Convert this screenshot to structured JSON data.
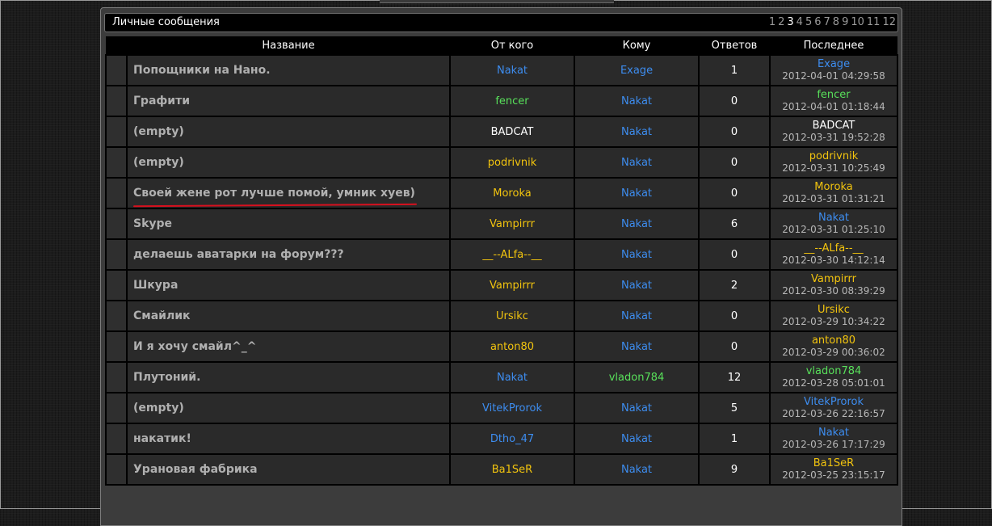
{
  "header": {
    "title": "Личные сообщения",
    "pages": [
      "1",
      "2",
      "3",
      "4",
      "5",
      "6",
      "7",
      "8",
      "9",
      "10",
      "11",
      "12"
    ],
    "current_page": "3"
  },
  "columns": {
    "title": "Название",
    "from": "От кого",
    "to": "Кому",
    "replies": "Ответов",
    "last": "Последнее"
  },
  "colors": {
    "blue": "#3d8df0",
    "green": "#58e05a",
    "yellow": "#f2c40e",
    "white": "#ffffff",
    "red_underline": "#d8101e"
  },
  "rows": [
    {
      "title": "Попощники на Нано.",
      "from": "Nakat",
      "from_color": "blue",
      "to": "Exage",
      "to_color": "blue",
      "replies": "1",
      "last_user": "Exage",
      "last_color": "blue",
      "last_ts": "2012-04-01 04:29:58",
      "underlined": false
    },
    {
      "title": "Графити",
      "from": "fencer",
      "from_color": "green",
      "to": "Nakat",
      "to_color": "blue",
      "replies": "0",
      "last_user": "fencer",
      "last_color": "green",
      "last_ts": "2012-04-01 01:18:44",
      "underlined": false
    },
    {
      "title": "(empty)",
      "from": "BADCAT",
      "from_color": "white",
      "to": "Nakat",
      "to_color": "blue",
      "replies": "0",
      "last_user": "BADCAT",
      "last_color": "white",
      "last_ts": "2012-03-31 19:52:28",
      "underlined": false
    },
    {
      "title": "(empty)",
      "from": "podrivnik",
      "from_color": "yellow",
      "to": "Nakat",
      "to_color": "blue",
      "replies": "0",
      "last_user": "podrivnik",
      "last_color": "yellow",
      "last_ts": "2012-03-31 10:25:49",
      "underlined": false
    },
    {
      "title": "Своей жене рот лучше помой, умник хуев)",
      "from": "Moroka",
      "from_color": "yellow",
      "to": "Nakat",
      "to_color": "blue",
      "replies": "0",
      "last_user": "Moroka",
      "last_color": "yellow",
      "last_ts": "2012-03-31 01:31:21",
      "underlined": true
    },
    {
      "title": "Skype",
      "from": "Vampirrr",
      "from_color": "yellow",
      "to": "Nakat",
      "to_color": "blue",
      "replies": "6",
      "last_user": "Nakat",
      "last_color": "blue",
      "last_ts": "2012-03-31 01:25:10",
      "underlined": false
    },
    {
      "title": "делаешь аватарки на форум???",
      "from": "__--ALfa--__",
      "from_color": "yellow",
      "to": "Nakat",
      "to_color": "blue",
      "replies": "0",
      "last_user": "__--ALfa--__",
      "last_color": "yellow",
      "last_ts": "2012-03-30 14:12:14",
      "underlined": false
    },
    {
      "title": "Шкура",
      "from": "Vampirrr",
      "from_color": "yellow",
      "to": "Nakat",
      "to_color": "blue",
      "replies": "2",
      "last_user": "Vampirrr",
      "last_color": "yellow",
      "last_ts": "2012-03-30 08:39:29",
      "underlined": false
    },
    {
      "title": "Смайлик",
      "from": "Ursikc",
      "from_color": "yellow",
      "to": "Nakat",
      "to_color": "blue",
      "replies": "0",
      "last_user": "Ursikc",
      "last_color": "yellow",
      "last_ts": "2012-03-29 10:34:22",
      "underlined": false
    },
    {
      "title": "И я хочу смайл^_^",
      "from": "anton80",
      "from_color": "yellow",
      "to": "Nakat",
      "to_color": "blue",
      "replies": "0",
      "last_user": "anton80",
      "last_color": "yellow",
      "last_ts": "2012-03-29 00:36:02",
      "underlined": false
    },
    {
      "title": "Плутоний.",
      "from": "Nakat",
      "from_color": "blue",
      "to": "vladon784",
      "to_color": "green",
      "replies": "12",
      "last_user": "vladon784",
      "last_color": "green",
      "last_ts": "2012-03-28 05:01:01",
      "underlined": false
    },
    {
      "title": "(empty)",
      "from": "VitekProrok",
      "from_color": "blue",
      "to": "Nakat",
      "to_color": "blue",
      "replies": "5",
      "last_user": "VitekProrok",
      "last_color": "blue",
      "last_ts": "2012-03-26 22:16:57",
      "underlined": false
    },
    {
      "title": "накатик!",
      "from": "Dtho_47",
      "from_color": "blue",
      "to": "Nakat",
      "to_color": "blue",
      "replies": "1",
      "last_user": "Nakat",
      "last_color": "blue",
      "last_ts": "2012-03-26 17:17:29",
      "underlined": false
    },
    {
      "title": "Урановая фабрика",
      "from": "Ba1SeR",
      "from_color": "yellow",
      "to": "Nakat",
      "to_color": "blue",
      "replies": "9",
      "last_user": "Ba1SeR",
      "last_color": "yellow",
      "last_ts": "2012-03-25 23:15:17",
      "underlined": false
    }
  ]
}
